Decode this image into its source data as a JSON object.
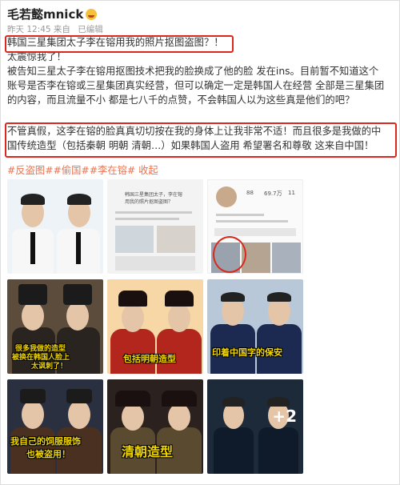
{
  "author": {
    "name": "毛若懿mnick"
  },
  "meta": {
    "time": "昨天 12:45 来自",
    "edited": "已编辑"
  },
  "post": {
    "lines1": [
      "韩国三星集团太子李在镕用我的照片抠图盗图？！",
      "太震惊我了！",
      "被告知三星太子李在镕用抠图技术把我的脸换成了他的脸 发在ins。目前暂不知道这个",
      "账号是否李在镕或三星集团真实经营，但可以确定一定是韩国人在经营 全部是三星集团",
      "的内容，而且流量不小 都是七八千的点赞，不会韩国人以为这些真是他们的吧？"
    ],
    "lines2": [
      "不管真假，这李在镕的脸真真切切按在我的身体上让我非常不适！而且很多是我做的中",
      "国传统造型（包括秦朝 明朝 清朝…）如果韩国人盗用 希望署名和尊敬 这来自中国！"
    ],
    "tags": [
      "#反盗图#",
      "#偷国#",
      "#李在镕#",
      " 收起"
    ]
  },
  "images": {
    "doc": {
      "line1": "韩国三星集团太子，李在镕",
      "line2": "用我的照片抠图盗图？"
    },
    "profile": {
      "stats": [
        "88",
        "69.7万",
        "11"
      ]
    },
    "overlays": {
      "c3": [
        "很多我做的造型",
        "被换在韩国人脸上",
        "太讽刺了！"
      ],
      "c4": "包括明朝造型",
      "c5": "印着中国字的保安",
      "c6": [
        "我自己的饲服服饰",
        "也被盗用！"
      ],
      "c7": "清朝造型",
      "c8_more": "+2"
    }
  },
  "colors": {
    "highlight": "#d9281d",
    "tag": "#eb7350",
    "overlay_yellow": "#f2d600"
  }
}
